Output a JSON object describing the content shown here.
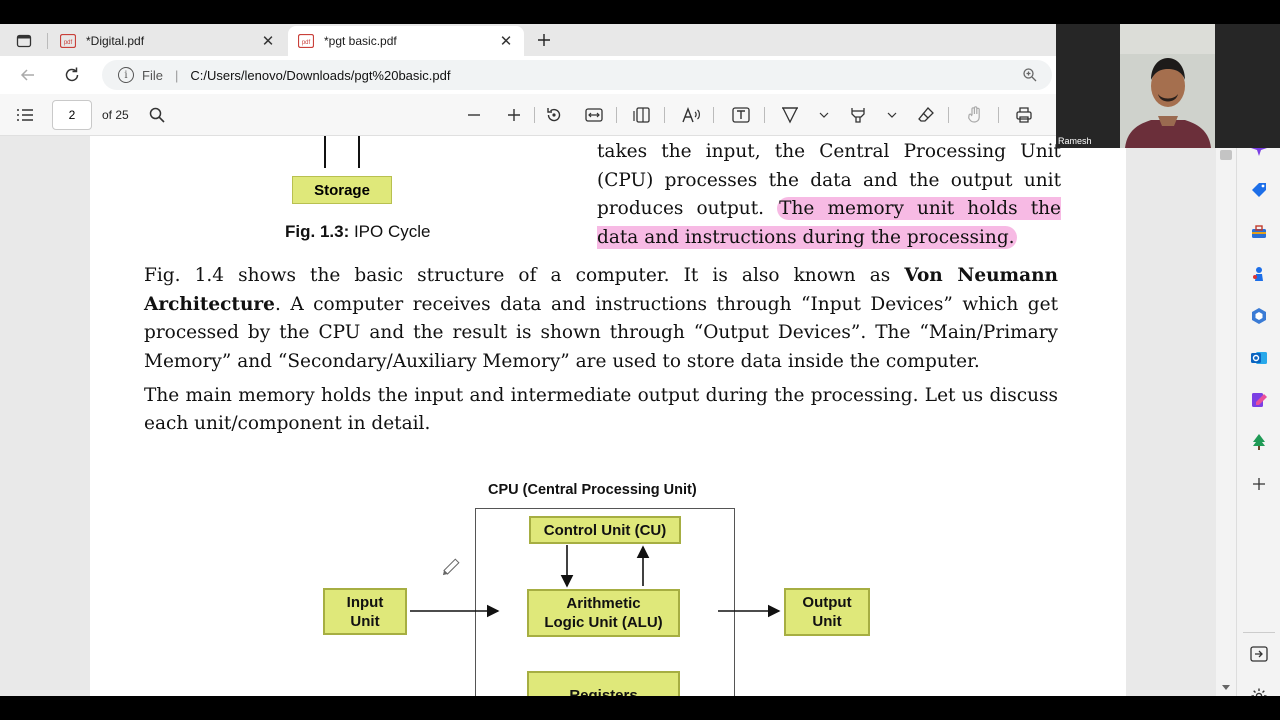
{
  "tabs": [
    {
      "title": "*Digital.pdf",
      "icon": "pdf-icon",
      "active": false
    },
    {
      "title": "*pgt basic.pdf",
      "icon": "pdf-icon",
      "active": true
    }
  ],
  "address": {
    "scheme_label": "File",
    "url": "C:/Users/lenovo/Downloads/pgt%20basic.pdf"
  },
  "pdf_toolbar": {
    "page": "2",
    "of_pages": "of 25"
  },
  "document": {
    "storage_label": "Storage",
    "fig13_bold": "Fig. 1.3:",
    "fig13_text": " IPO Cycle",
    "right_para_plain": "takes the input, the Central Processing Unit (CPU) processes the data and the output unit produces output.",
    "right_para_highlight": "The memory unit holds the data and instructions during the processing.",
    "para1_start": "Fig. 1.4 shows the basic structure of a computer. It is also known as ",
    "para1_bold": "Von Neumann Architecture",
    "para1_end": ". A computer receives data and instructions through “Input Devices” which get processed by the CPU and the result is shown through “Output Devices”. The “Main/Primary Memory” and “Secondary/Auxiliary Memory” are used to store data inside the computer.",
    "para2": "The main memory holds the input and intermediate output during the processing. Let us discuss each unit/component in detail."
  },
  "diagram": {
    "cpu_title": "CPU (Central Processing Unit)",
    "control_unit": "Control Unit (CU)",
    "alu_line1": "Arithmetic",
    "alu_line2": "Logic Unit (ALU)",
    "input_line1": "Input",
    "input_line2": "Unit",
    "output_line1": "Output",
    "output_line2": "Unit",
    "registers": "Registers"
  },
  "webcam": {
    "name": "Ramesh"
  },
  "colors": {
    "highlight": "#f082cd",
    "diagram_box": "#dfe87a",
    "diagram_border": "#a6ae42"
  }
}
